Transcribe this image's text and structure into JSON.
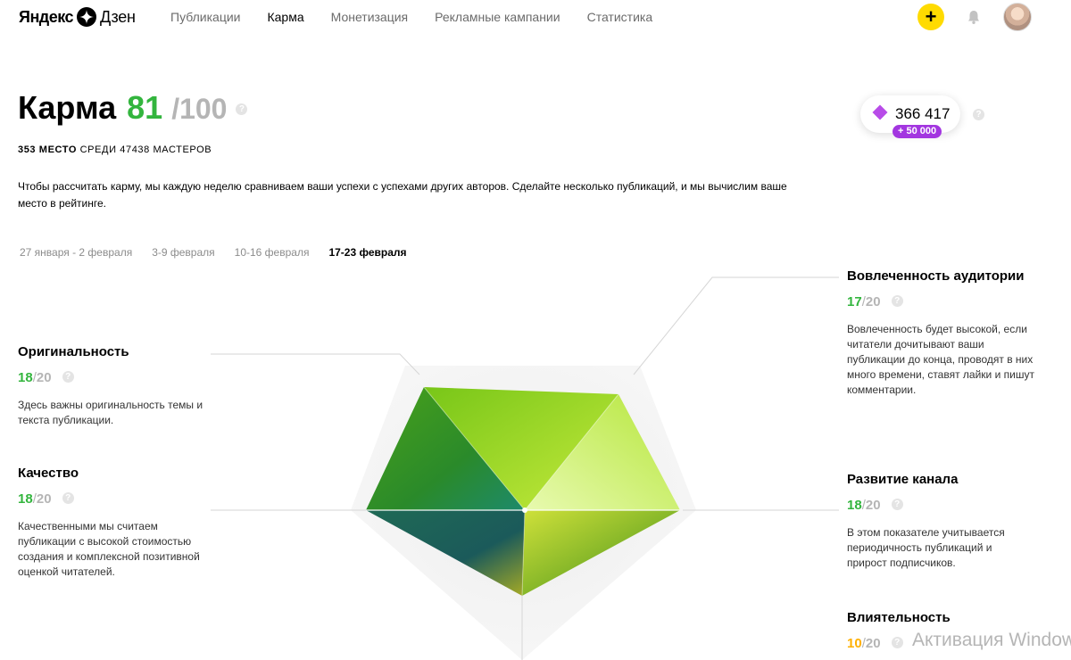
{
  "header": {
    "logo_left": "Яндекс",
    "logo_right": "Дзен",
    "nav": [
      {
        "label": "Публикации",
        "active": false
      },
      {
        "label": "Карма",
        "active": true
      },
      {
        "label": "Монетизация",
        "active": false
      },
      {
        "label": "Рекламные кампании",
        "active": false
      },
      {
        "label": "Статистика",
        "active": false
      }
    ],
    "plus_label": "+",
    "icons": [
      "plus-icon",
      "bell-icon",
      "avatar"
    ]
  },
  "karma": {
    "title": "Карма",
    "value": "81",
    "max": "/100",
    "help": "?",
    "rank_place": "353 место",
    "rank_rest": "среди 47438 мастеров",
    "description": "Чтобы рассчитать карму, мы каждую неделю сравниваем ваши успехи с успехами других авторов. Сделайте несколько публикаций, и мы вычислим ваше место в рейтинге."
  },
  "points": {
    "value": "366 417",
    "bonus": "+ 50 000",
    "help": "?"
  },
  "weeks": [
    {
      "label": "27 января - 2 февраля",
      "active": false
    },
    {
      "label": "3-9 февраля",
      "active": false
    },
    {
      "label": "10-16 февраля",
      "active": false
    },
    {
      "label": "17-23 февраля",
      "active": true
    }
  ],
  "criteria": {
    "originality": {
      "name": "Оригинальность",
      "value": "18",
      "max": "20",
      "text": "Здесь важны оригинальность темы и текста публикации."
    },
    "quality": {
      "name": "Качество",
      "value": "18",
      "max": "20",
      "text": "Качественными мы считаем публикации с высокой стоимостью создания и комплексной позитивной оценкой читателей."
    },
    "engagement": {
      "name": "Вовлеченность аудитории",
      "value": "17",
      "max": "20",
      "text": "Вовлеченность будет высокой, если читатели дочитывают ваши публикации до конца, проводят в них много времени, ставят лайки и пишут комментарии."
    },
    "growth": {
      "name": "Развитие канала",
      "value": "18",
      "max": "20",
      "text": "В этом показателе учитывается периодичность публикаций и прирост подписчиков."
    },
    "influence": {
      "name": "Влиятельность",
      "value": "10",
      "max": "20",
      "text": ""
    }
  },
  "colors": {
    "green": "#33b53e",
    "yellow": "#ffdb00",
    "purple": "#a336e0",
    "warn": "#ffb000"
  },
  "watermark": "Активация Windows"
}
